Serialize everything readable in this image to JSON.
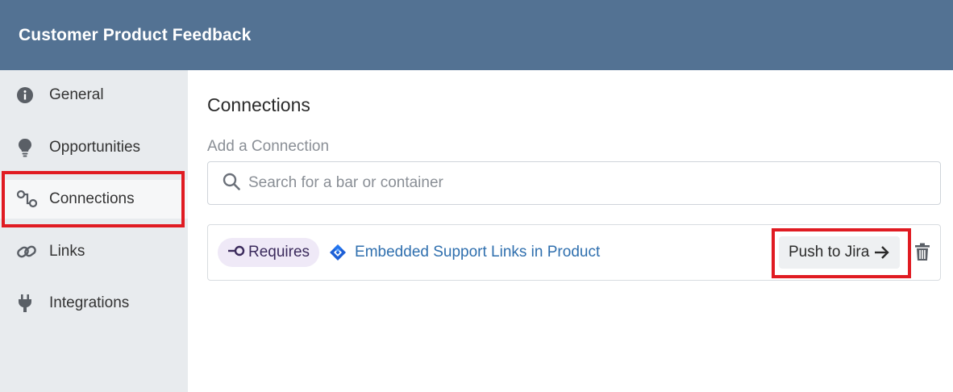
{
  "header": {
    "title": "Customer Product Feedback"
  },
  "sidebar": {
    "items": [
      {
        "label": "General",
        "icon": "info-circle-icon"
      },
      {
        "label": "Opportunities",
        "icon": "lightbulb-icon"
      },
      {
        "label": "Connections",
        "icon": "connections-icon",
        "active": true
      },
      {
        "label": "Links",
        "icon": "link-icon"
      },
      {
        "label": "Integrations",
        "icon": "plug-icon"
      }
    ]
  },
  "main": {
    "title": "Connections",
    "add_label": "Add a Connection",
    "search": {
      "placeholder": "Search for a bar or container",
      "value": ""
    },
    "connections": [
      {
        "relation": "Requires",
        "item_icon": "jira-icon",
        "item_name": "Embedded Support Links in Product",
        "action_label": "Push to Jira"
      }
    ]
  },
  "colors": {
    "header_bg": "#537293",
    "sidebar_bg": "#e8ebee",
    "highlight": "#e01b22",
    "link": "#2f6fae",
    "badge_bg": "#efe9f7"
  }
}
